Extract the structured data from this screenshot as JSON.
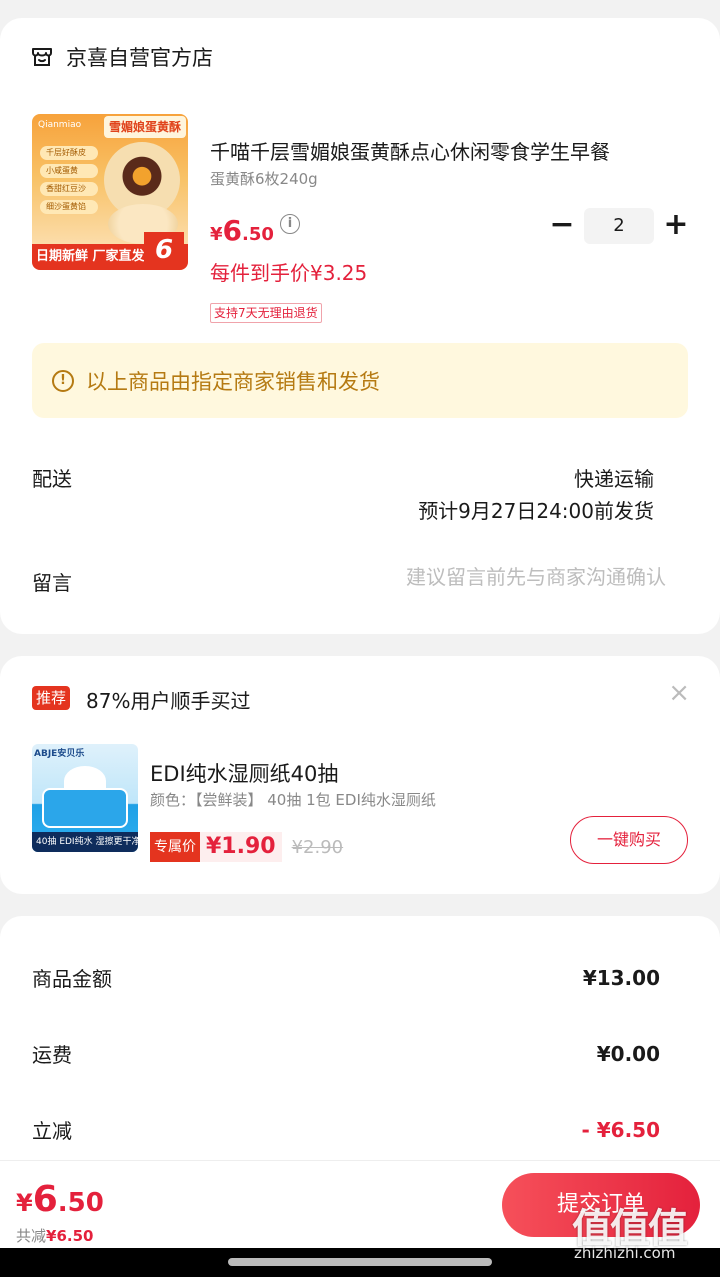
{
  "store": {
    "name": "京喜自营官方店"
  },
  "product": {
    "title": "千喵千层雪媚娘蛋黄酥点心休闲零食学生早餐",
    "spec": "蛋黄酥6枚240g",
    "price_yen": "¥",
    "price_int": "6",
    "price_dec": ".50",
    "unit_price": "每件到手价¥3.25",
    "return_policy": "支持7天无理由退货",
    "quantity": "2",
    "image": {
      "banner": "雪媚娘蛋黄酥",
      "brand": "Qianmiao",
      "tags": [
        "千层好酥皮",
        "小咸蛋黄",
        "香甜红豆沙",
        "细沙蛋黄馅"
      ],
      "footer": "日期新鲜 厂家直发",
      "count": "6"
    }
  },
  "notice": {
    "text": "以上商品由指定商家销售和发货"
  },
  "delivery": {
    "label": "配送",
    "method": "快递运输",
    "eta": "预计9月27日24:00前发货"
  },
  "message": {
    "label": "留言",
    "placeholder": "建议留言前先与商家沟通确认"
  },
  "recommend": {
    "badge": "推荐",
    "headline": "87%用户顺手买过",
    "close": "×",
    "item": {
      "name": "EDI纯水湿厕纸40抽",
      "spec": "颜色：【尝鲜装】 40抽 1包 EDI纯水湿厕纸",
      "exclusive_label": "专属价",
      "price": "¥1.90",
      "original_price": "¥2.90",
      "image_brand": "ABJE安贝乐",
      "image_bar": "40抽 EDI纯水 湿擦更干净"
    },
    "buy_button": "一键购买"
  },
  "summary": {
    "goods_label": "商品金额",
    "goods_value": "¥13.00",
    "shipping_label": "运费",
    "shipping_value": "¥0.00",
    "discount_label": "立减",
    "discount_value": "- ¥6.50"
  },
  "checkout": {
    "total_yen": "¥",
    "total_int": "6",
    "total_dec": ".50",
    "saved_label": "共减",
    "saved_value": "¥6.50",
    "submit": "提交订单"
  },
  "watermark": {
    "logo": "值值值",
    "url": "zhizhizhi.com"
  },
  "colors": {
    "accent": "#e4213c",
    "notice_bg": "#fff8de",
    "notice_text": "#b57a12"
  },
  "icons": [
    "store-icon",
    "info-icon",
    "minus-icon",
    "plus-icon",
    "alert-icon",
    "close-icon"
  ]
}
